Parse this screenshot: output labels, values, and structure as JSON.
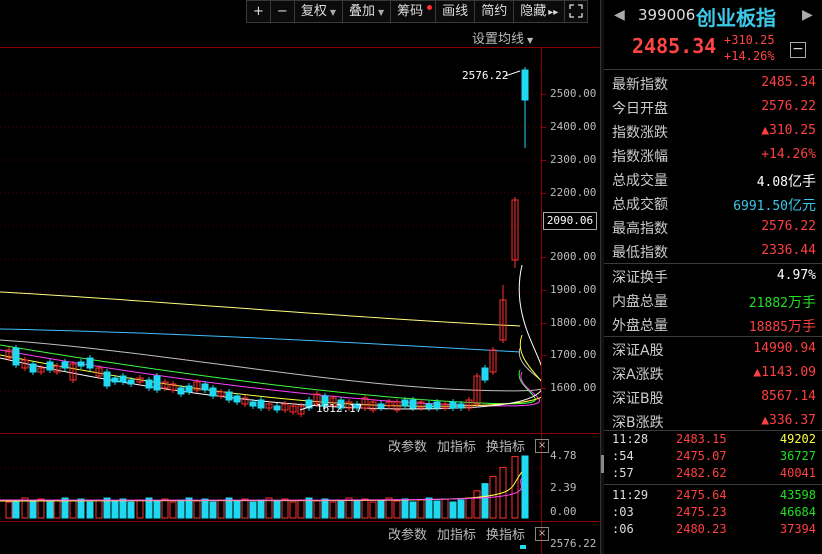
{
  "toolbar": {
    "plus_label": "+",
    "minus_label": "−",
    "fuquan_label": "复权",
    "diejia_label": "叠加",
    "chouma_label": "筹码",
    "huaxian_label": "画线",
    "jianyue_label": "简约",
    "yincang_label": "隐藏",
    "yincang_arrows": "▸▸",
    "fullscreen_icon": "fullscreen-icon"
  },
  "main_chart": {
    "ma_settings_label": "设置均线",
    "y_labels": [
      "2500.00",
      "2400.00",
      "2300.00",
      "2200.00",
      "2000.00",
      "1900.00",
      "1800.00",
      "1700.00",
      "1600.00"
    ],
    "current_price_tag": "2090.06",
    "high_annotation": "2576.22",
    "low_annotation": "1612.17"
  },
  "sub_chart_1": {
    "params_label": "改参数",
    "add_indicator_label": "加指标",
    "switch_indicator_label": "换指标",
    "close_label": "×",
    "y_labels": [
      "4.78",
      "2.39",
      "0.00"
    ]
  },
  "sub_chart_2": {
    "params_label": "改参数",
    "add_indicator_label": "加指标",
    "switch_indicator_label": "换指标",
    "close_label": "×",
    "y_label": "2576.22"
  },
  "quote": {
    "code": "399006",
    "name": "创业板指",
    "price": "2485.34",
    "change": "+310.25",
    "change_pct": "+14.26%",
    "collapse_label": "−",
    "rows": [
      {
        "label": "最新指数",
        "value": "2485.34",
        "unit": "",
        "color": "red"
      },
      {
        "label": "今日开盘",
        "value": "2576.22",
        "unit": "",
        "color": "red"
      },
      {
        "label": "指数涨跌",
        "value": "▲310.25",
        "unit": "",
        "color": "red"
      },
      {
        "label": "指数涨幅",
        "value": "+14.26%",
        "unit": "",
        "color": "red"
      },
      {
        "label": "总成交量",
        "value": "4.08",
        "unit": "亿手",
        "color": "white"
      },
      {
        "label": "总成交额",
        "value": "6991.50",
        "unit": "亿元",
        "color": "cyan"
      },
      {
        "label": "最高指数",
        "value": "2576.22",
        "unit": "",
        "color": "red"
      },
      {
        "label": "最低指数",
        "value": "2336.44",
        "unit": "",
        "color": "red"
      },
      {
        "label": "深证换手",
        "value": "4.97%",
        "unit": "",
        "color": "white"
      },
      {
        "label": "内盘总量",
        "value": "21882",
        "unit": "万手",
        "color": "green"
      },
      {
        "label": "外盘总量",
        "value": "18885",
        "unit": "万手",
        "color": "red"
      },
      {
        "label": "深证A股",
        "value": "14990.94",
        "unit": "",
        "color": "red"
      },
      {
        "label": "深A涨跌",
        "value": "▲1143.09",
        "unit": "",
        "color": "red"
      },
      {
        "label": "深证B股",
        "value": "8567.14",
        "unit": "",
        "color": "red"
      },
      {
        "label": "深B涨跌",
        "value": "▲336.37",
        "unit": "",
        "color": "red"
      }
    ],
    "ticks": [
      {
        "time": "11:28",
        "price": "2483.15",
        "vol": "49202",
        "color": "yellow"
      },
      {
        "time": ":54",
        "price": "2475.07",
        "vol": "36727",
        "color": "green"
      },
      {
        "time": ":57",
        "price": "2482.62",
        "vol": "40041",
        "color": "red"
      },
      {
        "time": "11:29",
        "price": "2475.64",
        "vol": "43598",
        "color": "green"
      },
      {
        "time": ":03",
        "price": "2475.23",
        "vol": "46684",
        "color": "green"
      },
      {
        "time": ":06",
        "price": "2480.23",
        "vol": "37394",
        "color": "red"
      }
    ]
  },
  "colors": {
    "up": "#ff3030",
    "down": "#20d8f0",
    "ma5": "#ffffff",
    "ma10": "#ffff40",
    "ma20": "#ff40ff",
    "ma30": "#40ff40",
    "ma60": "#c0c0c0",
    "ma120": "#40c0ff",
    "ma250": "#ffff80"
  }
}
